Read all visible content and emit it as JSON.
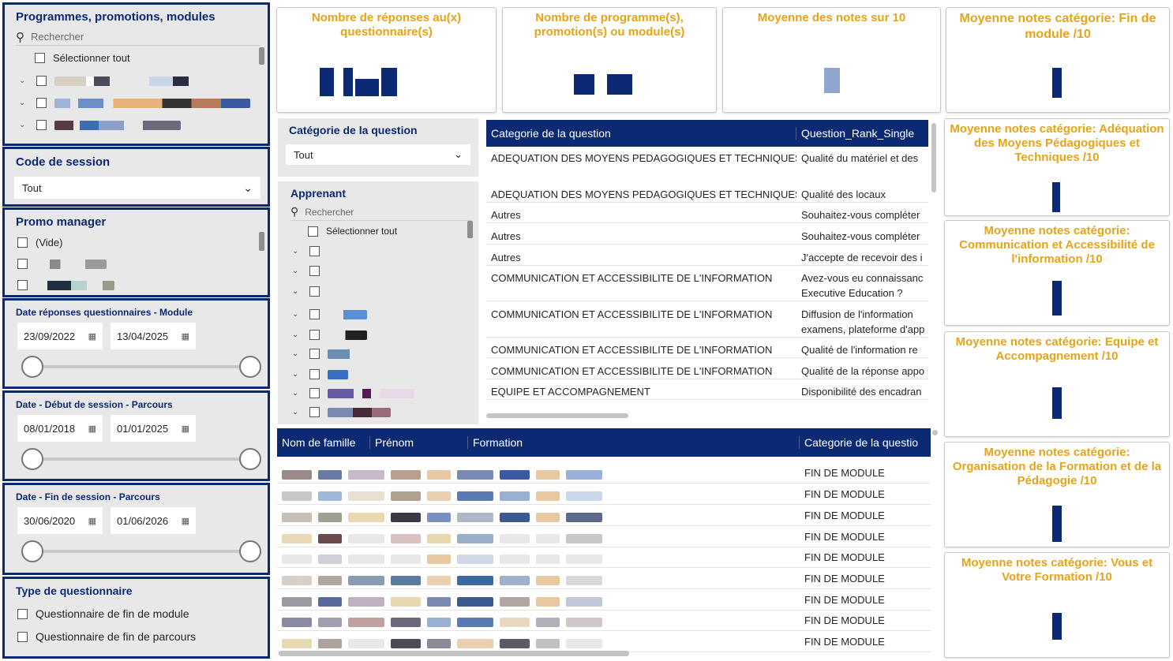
{
  "filters": {
    "programmes": {
      "title": "Programmes, promotions, modules",
      "search_placeholder": "Rechercher",
      "select_all": "Sélectionner tout"
    },
    "code_session": {
      "title": "Code de session",
      "value": "Tout"
    },
    "promo_manager": {
      "title": "Promo manager",
      "items": [
        "(Vide)"
      ]
    },
    "date_reponses": {
      "title": "Date réponses questionnaires - Module",
      "start": "23/09/2022",
      "end": "13/04/2025"
    },
    "date_debut": {
      "title": "Date - Début de session - Parcours",
      "start": "08/01/2018",
      "end": "01/01/2025"
    },
    "date_fin": {
      "title": "Date - Fin de session - Parcours",
      "start": "30/06/2020",
      "end": "01/06/2026"
    },
    "type_questionnaire": {
      "title": "Type de questionnaire",
      "options": [
        "Questionnaire de fin de module",
        "Questionnaire de fin de parcours"
      ]
    }
  },
  "middle_filters": {
    "categorie": {
      "title": "Catégorie de la question",
      "value": "Tout"
    },
    "apprenant": {
      "title": "Apprenant",
      "search_placeholder": "Rechercher",
      "select_all": "Sélectionner tout"
    }
  },
  "kpis": {
    "nb_reponses": "Nombre de réponses au(x) questionnaire(s)",
    "nb_programmes": "Nombre de programme(s), promotion(s) ou module(s)",
    "moyenne": "Moyenne des notes sur 10"
  },
  "category_cards": [
    "Moyenne notes catégorie: Fin de module /10",
    "Moyenne notes catégorie: Adéquation des Moyens Pédagogiques et Techniques /10",
    "Moyenne notes catégorie: Communication et Accessibilité de l'information /10",
    "Moyenne notes catégorie: Equipe et Accompagnement /10",
    "Moyenne notes catégorie: Organisation de la Formation et de la Pédagogie /10",
    "Moyenne notes catégorie: Vous et Votre Formation /10"
  ],
  "question_table": {
    "columns": [
      "Categorie de la question",
      "Question_Rank_Single"
    ],
    "rows": [
      [
        "ADEQUATION DES MOYENS PEDAGOGIQUES ET TECHNIQUES",
        "Qualité du matériel et des"
      ],
      [
        "ADEQUATION DES MOYENS PEDAGOGIQUES ET TECHNIQUES",
        "Qualité des locaux"
      ],
      [
        "Autres",
        "Souhaitez-vous compléter"
      ],
      [
        "Autres",
        "Souhaitez-vous compléter"
      ],
      [
        "Autres",
        "J'accepte de recevoir des i"
      ],
      [
        "COMMUNICATION ET ACCESSIBILITE DE L'INFORMATION",
        "Avez-vous eu connaissanc"
      ],
      [
        "",
        "Executive Education ?"
      ],
      [
        "COMMUNICATION ET ACCESSIBILITE DE L'INFORMATION",
        "Diffusion de l'information"
      ],
      [
        "",
        "examens, plateforme d'app"
      ],
      [
        "COMMUNICATION ET ACCESSIBILITE DE L'INFORMATION",
        "Qualité de l'information re"
      ],
      [
        "COMMUNICATION ET ACCESSIBILITE DE L'INFORMATION",
        "Qualité de la réponse appo"
      ],
      [
        "EQUIPE ET ACCOMPAGNEMENT",
        "Disponibilité des encadran"
      ]
    ]
  },
  "learner_table": {
    "columns": [
      "Nom de famille",
      "Prénom",
      "Formation",
      "Categorie de la questio"
    ],
    "category_values": [
      "FIN DE MODULE",
      "FIN DE MODULE",
      "FIN DE MODULE",
      "FIN DE MODULE",
      "FIN DE MODULE",
      "FIN DE MODULE",
      "FIN DE MODULE",
      "FIN DE MODULE",
      "FIN DE MODULE"
    ]
  },
  "colors": {
    "navy": "#0b2a73",
    "gold": "#e8a317",
    "panel_bg": "#e8e8e8"
  }
}
